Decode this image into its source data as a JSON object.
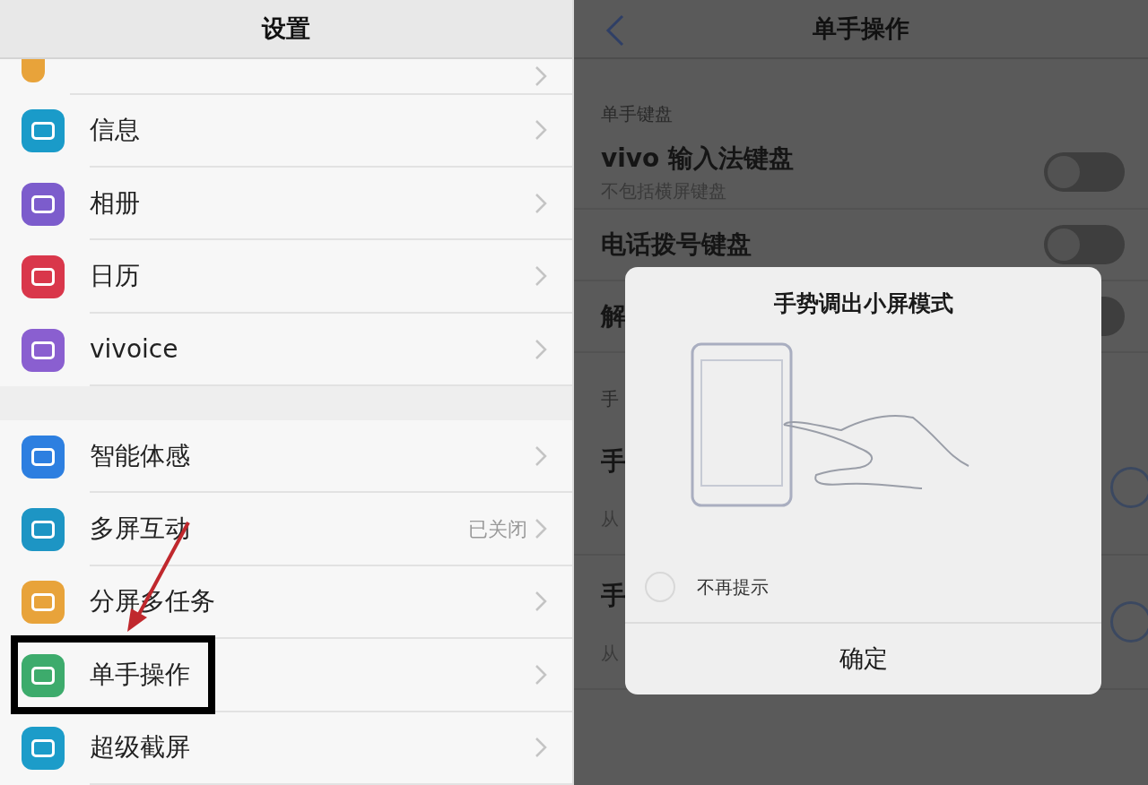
{
  "settings": {
    "title": "设置",
    "groups": [
      [
        {
          "partial": true,
          "color": "#e8a33a",
          "annotated": false
        },
        {
          "label": "信息",
          "color": "#1a9bc9",
          "annotated": false
        },
        {
          "label": "相册",
          "color": "#7c5ccc",
          "annotated": false
        },
        {
          "label": "日历",
          "color": "#d9374b",
          "annotated": false
        },
        {
          "label": "vivoice",
          "color": "#8a5fd0",
          "annotated": false
        }
      ],
      [
        {
          "label": "智能体感",
          "color": "#2d7fe0",
          "annotated": false
        },
        {
          "label": "多屏互动",
          "value": "已关闭",
          "color": "#1d95c4",
          "annotated": false
        },
        {
          "label": "分屏多任务",
          "color": "#e8a33a",
          "annotated": false
        },
        {
          "label": "单手操作",
          "color": "#3dab6c",
          "annotated": true
        },
        {
          "label": "超级截屏",
          "color": "#1c9cc9",
          "annotated": false
        }
      ]
    ]
  },
  "one_hand": {
    "title": "单手操作",
    "keyboard_section": {
      "label": "单手键盘",
      "rows": [
        {
          "label": "vivo 输入法键盘",
          "subtitle": "不包括横屏键盘",
          "on": false
        },
        {
          "label": "电话拨号键盘",
          "on": false
        },
        {
          "label": "解",
          "on": false
        }
      ]
    },
    "gesture_section": {
      "label": "手",
      "rows": [
        {
          "label": "手",
          "subtitle": "从",
          "selected": false
        },
        {
          "label": "手",
          "subtitle": "从",
          "selected": false
        }
      ]
    }
  },
  "dialog": {
    "title": "手势调出小屏模式",
    "dont_remind": {
      "label": "不再提示",
      "checked": false
    },
    "confirm": "确定"
  }
}
